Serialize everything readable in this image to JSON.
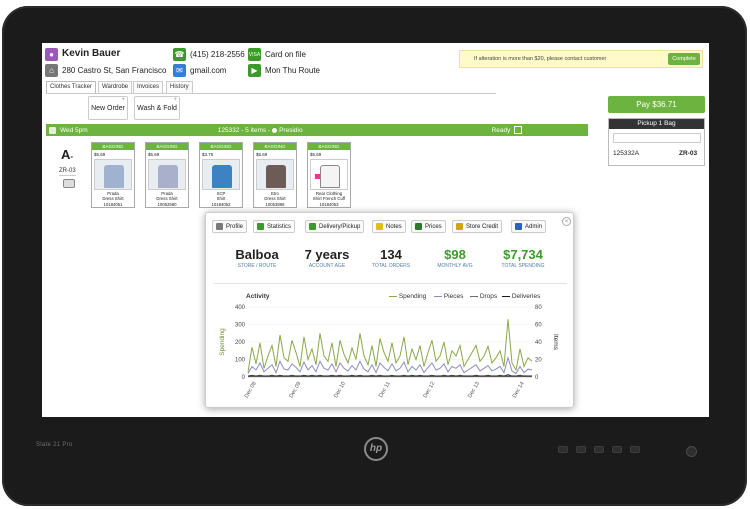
{
  "customer": {
    "name": "Kevin Bauer",
    "address": "280 Castro St, San Francisco",
    "phone": "(415) 218-2556",
    "email": "gmail.com",
    "card": "Card on file",
    "route_days": "Mon Thu Route"
  },
  "notice": {
    "text": "If alteration is more than $20, please contact customer",
    "button": "Complete"
  },
  "tabs": [
    "Clothes Tracker",
    "Wardrobe",
    "Invoices",
    "History"
  ],
  "actions": {
    "new_order": "New Order",
    "wash_fold": "Wash & Fold",
    "plus": "+"
  },
  "order": {
    "day": "Wed 5pm",
    "summary": "125332 - 5 items - ",
    "store": "Presidio",
    "status": "Ready"
  },
  "badge": {
    "grade": "A",
    "mark": "-",
    "code": "ZR-03"
  },
  "items": [
    {
      "tag": "BAGGING",
      "price": "$5.69",
      "line1": "Prada",
      "line2": "Dress Shirt",
      "line3": "10184051",
      "color": "#9fb2d0"
    },
    {
      "tag": "BAGGING",
      "price": "$5.69",
      "line1": "Prada",
      "line2": "Dress Shirt",
      "line3": "10052580",
      "color": "#a9b0cc"
    },
    {
      "tag": "BAGGING",
      "price": "$3.75",
      "line1": "SCP",
      "line2": "Shirt",
      "line3": "10184052",
      "color": "#3e82c4"
    },
    {
      "tag": "BAGGING",
      "price": "$5.69",
      "line1": "Etro",
      "line2": "Dress Shirt",
      "line3": "10053896",
      "color": "#6d5b55"
    },
    {
      "tag": "BAGGING",
      "price": "$5.69",
      "line1": "Rear Clothing",
      "line2": "Shirt French Cuff",
      "line3": "10184053",
      "color": "#f4f4f4"
    }
  ],
  "pay": {
    "label": "Pay $36.71"
  },
  "pickup": {
    "title": "Pickup 1 Bag",
    "order": "125332A",
    "code": "ZR-03"
  },
  "modal": {
    "tabs": [
      {
        "label": "Profile",
        "icon": "profile-icon",
        "color": "#7a7a7a"
      },
      {
        "label": "Statistics",
        "icon": "statistics-icon",
        "color": "#3c9a2b"
      },
      {
        "label": "Delivery/Pickup",
        "icon": "delivery-icon",
        "color": "#3c9a2b"
      },
      {
        "label": "Notes",
        "icon": "notes-icon",
        "color": "#e0c000"
      },
      {
        "label": "Prices",
        "icon": "prices-icon",
        "color": "#2c7a2c"
      },
      {
        "label": "Store Credit",
        "icon": "store-credit-icon",
        "color": "#d4a500"
      },
      {
        "label": "Admin",
        "icon": "admin-icon",
        "color": "#2f5fbf"
      }
    ],
    "stats": [
      {
        "value": "Balboa",
        "label": "STORE / ROUTE"
      },
      {
        "value": "7 years",
        "label": "ACCOUNT AGE"
      },
      {
        "value": "134",
        "label": "TOTAL ORDERS"
      },
      {
        "value": "$98",
        "label": "MONTHLY AVG"
      },
      {
        "value": "$7,734",
        "label": "TOTAL SPENDING"
      }
    ]
  },
  "chart_data": {
    "type": "line",
    "title": "Activity",
    "ylabel": "Spending",
    "y2label": "Items",
    "ylim": [
      0,
      400
    ],
    "y2lim": [
      0,
      80
    ],
    "yticks": [
      0,
      100,
      200,
      300,
      400
    ],
    "y2ticks": [
      0,
      20,
      40,
      60,
      80
    ],
    "xticks": [
      "Dec 08",
      "Dec 09",
      "Dec 10",
      "Dec 11",
      "Dec 12",
      "Dec 13",
      "Dec 14"
    ],
    "legend": "top-right",
    "series": [
      {
        "name": "Spending",
        "axis": "left",
        "color": "#8aa84a",
        "values": [
          30,
          170,
          75,
          195,
          50,
          120,
          180,
          60,
          240,
          110,
          90,
          210,
          140,
          60,
          230,
          100,
          160,
          70,
          250,
          120,
          90,
          195,
          60,
          210,
          130,
          80,
          165,
          100,
          250,
          120,
          70,
          180,
          60,
          220,
          140,
          90,
          195,
          80,
          120,
          230,
          70,
          160,
          100,
          180,
          60,
          140,
          210,
          90,
          120,
          200,
          70,
          150,
          120,
          180,
          60,
          100,
          140,
          180,
          90,
          120,
          175,
          80,
          110,
          150,
          60,
          330,
          80,
          40,
          160,
          60,
          110,
          90
        ]
      },
      {
        "name": "Pieces",
        "axis": "right",
        "color": "#8c8cc4",
        "values": [
          4,
          12,
          8,
          16,
          6,
          10,
          14,
          5,
          18,
          9,
          8,
          15,
          11,
          6,
          17,
          8,
          13,
          6,
          18,
          10,
          8,
          15,
          6,
          16,
          10,
          7,
          13,
          8,
          18,
          9,
          6,
          14,
          5,
          16,
          11,
          7,
          15,
          7,
          10,
          17,
          6,
          12,
          8,
          14,
          5,
          11,
          16,
          8,
          10,
          15,
          6,
          12,
          10,
          14,
          5,
          8,
          11,
          14,
          7,
          10,
          13,
          7,
          9,
          12,
          5,
          22,
          7,
          4,
          12,
          5,
          9,
          8
        ]
      },
      {
        "name": "Drops",
        "axis": "right",
        "color": "#6c6c6c",
        "values": [
          1,
          2,
          1,
          2,
          1,
          1,
          2,
          1,
          2,
          1,
          1,
          2,
          1,
          1,
          2,
          1,
          2,
          1,
          2,
          1,
          1,
          2,
          1,
          2,
          1,
          1,
          2,
          1,
          2,
          1,
          1,
          2,
          1,
          2,
          1,
          1,
          2,
          1,
          1,
          2,
          1,
          2,
          1,
          2,
          1,
          1,
          2,
          1,
          1,
          2,
          1,
          2,
          1,
          2,
          1,
          1,
          1,
          2,
          1,
          1,
          2,
          1,
          1,
          2,
          1,
          3,
          1,
          1,
          2,
          1,
          1,
          1
        ]
      },
      {
        "name": "Deliveries",
        "axis": "right",
        "color": "#1a1a1a",
        "values": [
          1,
          1,
          1,
          1,
          1,
          1,
          1,
          1,
          1,
          1,
          1,
          1,
          1,
          1,
          1,
          1,
          1,
          1,
          1,
          1,
          1,
          1,
          1,
          1,
          1,
          1,
          1,
          1,
          1,
          1,
          1,
          1,
          1,
          1,
          1,
          1,
          1,
          1,
          1,
          1,
          1,
          1,
          1,
          1,
          1,
          1,
          1,
          1,
          1,
          1,
          1,
          1,
          1,
          1,
          1,
          1,
          1,
          1,
          1,
          1,
          1,
          1,
          1,
          1,
          1,
          1,
          1,
          1,
          1,
          1,
          1,
          1
        ]
      }
    ]
  },
  "bezel": {
    "model": "Slate 21 Pro",
    "brand": "hp"
  }
}
